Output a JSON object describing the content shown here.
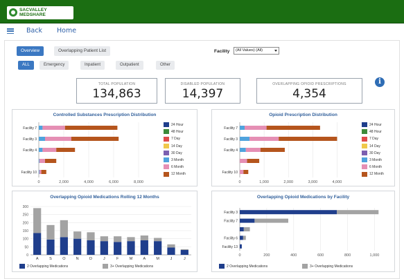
{
  "header": {
    "logo_line1": "SACVALLEY",
    "logo_line2": "MEDSHARE",
    "nav_back": "Back",
    "nav_home": "Home"
  },
  "tabs": {
    "primary": [
      "Overview",
      "Overlapping Patient List"
    ],
    "secondary": [
      "ALL",
      "Emergency",
      "Inpatient",
      "Outpatient",
      "Other"
    ]
  },
  "filter": {
    "label": "Facility",
    "value": "(All Values) (All)"
  },
  "kpis": [
    {
      "label": "TOTAL POPULATION",
      "value": "134,863"
    },
    {
      "label": "DISABLED POPULATION",
      "value": "14,397"
    },
    {
      "label": "OVERLAPPING OPIOID PRESCRIPTIONS",
      "value": "4,354"
    }
  ],
  "colors": {
    "accent": "#2f6db5",
    "header_green": "#1b6e12",
    "title_blue": "#2f5e9a"
  },
  "info_icon": "info-icon",
  "chart_data": [
    {
      "type": "bar",
      "title": "Controlled Substances Prescription Distribution",
      "orientation": "horizontal",
      "stacked": true,
      "categories": [
        "Facility 7",
        "Facility 3",
        "Facility 4",
        "",
        "Facility 10"
      ],
      "xticks": [
        "0",
        "2,000",
        "4,000",
        "6,000",
        "8,000"
      ],
      "xlim": [
        0,
        9000
      ],
      "series": [
        {
          "name": "24 Hour",
          "color": "#1f3e8c",
          "values": [
            0,
            0,
            0,
            0,
            0
          ]
        },
        {
          "name": "48 Hour",
          "color": "#3d8a3a",
          "values": [
            0,
            0,
            0,
            0,
            0
          ]
        },
        {
          "name": "7 Day",
          "color": "#e04b4b",
          "values": [
            0,
            0,
            0,
            0,
            0
          ]
        },
        {
          "name": "14 Day",
          "color": "#f0c84a",
          "values": [
            0,
            0,
            0,
            0,
            0
          ]
        },
        {
          "name": "30 Day",
          "color": "#7b5fb0",
          "values": [
            0,
            0,
            0,
            0,
            0
          ]
        },
        {
          "name": "3 Month",
          "color": "#4fa3dd",
          "values": [
            300,
            500,
            300,
            50,
            50
          ]
        },
        {
          "name": "6 Month",
          "color": "#e58fb4",
          "values": [
            1800,
            2100,
            1100,
            450,
            150
          ]
        },
        {
          "name": "12 Month",
          "color": "#b5551d",
          "values": [
            4200,
            3800,
            1500,
            900,
            400
          ]
        }
      ]
    },
    {
      "type": "bar",
      "title": "Opioid Prescription Distribution",
      "orientation": "horizontal",
      "stacked": true,
      "categories": [
        "Facility 7",
        "Facility 3",
        "Facility 4",
        "",
        "Facility 10"
      ],
      "xticks": [
        "0",
        "1,000",
        "2,000",
        "3,000",
        "4,000"
      ],
      "xlim": [
        0,
        4500
      ],
      "series": [
        {
          "name": "24 Hour",
          "color": "#1f3e8c",
          "values": [
            0,
            0,
            0,
            0,
            0
          ]
        },
        {
          "name": "48 Hour",
          "color": "#3d8a3a",
          "values": [
            0,
            0,
            0,
            0,
            0
          ]
        },
        {
          "name": "7 Day",
          "color": "#e04b4b",
          "values": [
            0,
            0,
            0,
            0,
            0
          ]
        },
        {
          "name": "14 Day",
          "color": "#f0c84a",
          "values": [
            0,
            0,
            0,
            0,
            0
          ]
        },
        {
          "name": "30 Day",
          "color": "#7b5fb0",
          "values": [
            0,
            0,
            0,
            0,
            0
          ]
        },
        {
          "name": "3 Month",
          "color": "#4fa3dd",
          "values": [
            200,
            400,
            250,
            0,
            0
          ]
        },
        {
          "name": "6 Month",
          "color": "#e58fb4",
          "values": [
            900,
            1200,
            600,
            300,
            150
          ]
        },
        {
          "name": "12 Month",
          "color": "#b5551d",
          "values": [
            2200,
            2400,
            1000,
            500,
            200
          ]
        }
      ]
    },
    {
      "type": "bar",
      "title": "Overlapping Opioid Medications Rolling 12 Months",
      "orientation": "vertical",
      "stacked": true,
      "categories": [
        "A",
        "S",
        "O",
        "N",
        "D",
        "J",
        "F",
        "M",
        "A",
        "M",
        "J",
        "J"
      ],
      "yticks": [
        "0",
        "50",
        "100",
        "150",
        "200",
        "250",
        "300"
      ],
      "ylim": [
        0,
        300
      ],
      "series": [
        {
          "name": "2 Overlapping Medications",
          "color": "#1f3e8c",
          "values": [
            135,
            95,
            110,
            100,
            90,
            85,
            80,
            85,
            90,
            85,
            45,
            30
          ]
        },
        {
          "name": "3+ Overlapping Medications",
          "color": "#a3a3a3",
          "values": [
            155,
            90,
            105,
            45,
            50,
            30,
            35,
            25,
            30,
            20,
            20,
            5
          ]
        }
      ]
    },
    {
      "type": "bar",
      "title": "Overlapping Opioid Medications by Facility",
      "orientation": "horizontal",
      "stacked": true,
      "categories": [
        "Facility 3",
        "Facility 7",
        "",
        "Facility 6",
        "Facility 13"
      ],
      "xticks": [
        "0",
        "200",
        "400",
        "600",
        "800",
        "1,000"
      ],
      "xlim": [
        0,
        1080
      ],
      "series": [
        {
          "name": "2 Overlapping Medications",
          "color": "#1f3e8c",
          "values": [
            720,
            110,
            30,
            25,
            15
          ]
        },
        {
          "name": "3+ Overlapping Medications",
          "color": "#a3a3a3",
          "values": [
            310,
            250,
            45,
            20,
            0
          ]
        }
      ]
    }
  ]
}
